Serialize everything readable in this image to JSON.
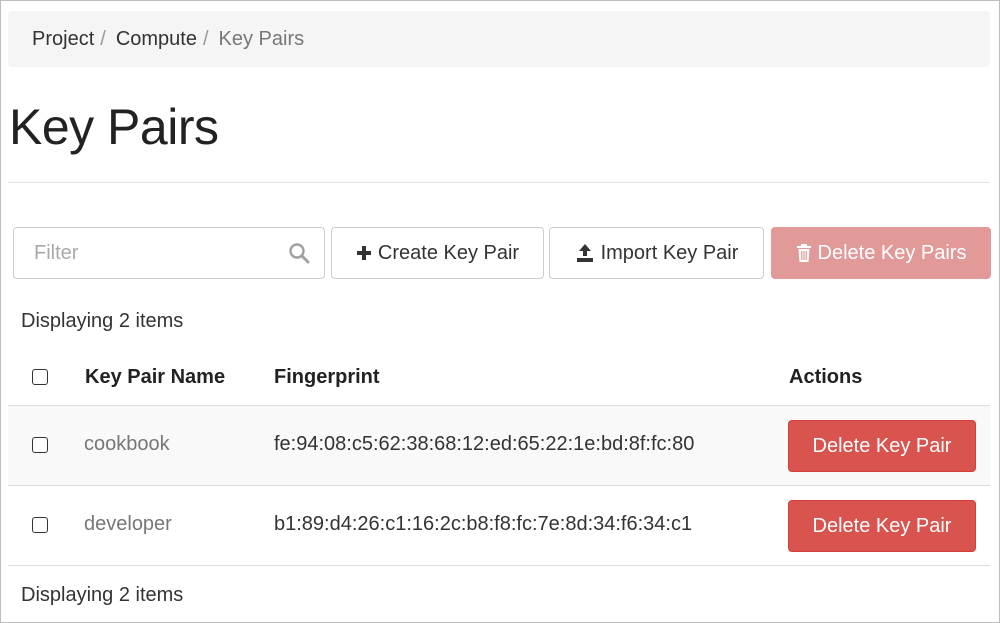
{
  "breadcrumb": {
    "items": [
      "Project",
      "Compute",
      "Key Pairs"
    ],
    "separator": "/"
  },
  "page": {
    "title": "Key Pairs"
  },
  "toolbar": {
    "filter_placeholder": "Filter",
    "filter_value": "",
    "create_label": "Create Key Pair",
    "create_icon": "plus-icon",
    "import_label": "Import Key Pair",
    "import_icon": "upload-icon",
    "delete_all_label": "Delete Key Pairs",
    "delete_all_icon": "trash-icon",
    "delete_all_enabled": false
  },
  "table": {
    "count_top": "Displaying 2 items",
    "count_bottom": "Displaying 2 items",
    "columns": [
      "Key Pair Name",
      "Fingerprint",
      "Actions"
    ],
    "rows": [
      {
        "name": "cookbook",
        "fingerprint": "fe:94:08:c5:62:38:68:12:ed:65:22:1e:bd:8f:fc:80",
        "action": "Delete Key Pair",
        "checked": false
      },
      {
        "name": "developer",
        "fingerprint": "b1:89:d4:26:c1:16:2c:b8:f8:fc:7e:8d:34:f6:34:c1",
        "action": "Delete Key Pair",
        "checked": false
      }
    ]
  },
  "colors": {
    "danger": "#d9534f",
    "danger_disabled": "#e29a99",
    "breadcrumb_bg": "#f5f5f5"
  }
}
